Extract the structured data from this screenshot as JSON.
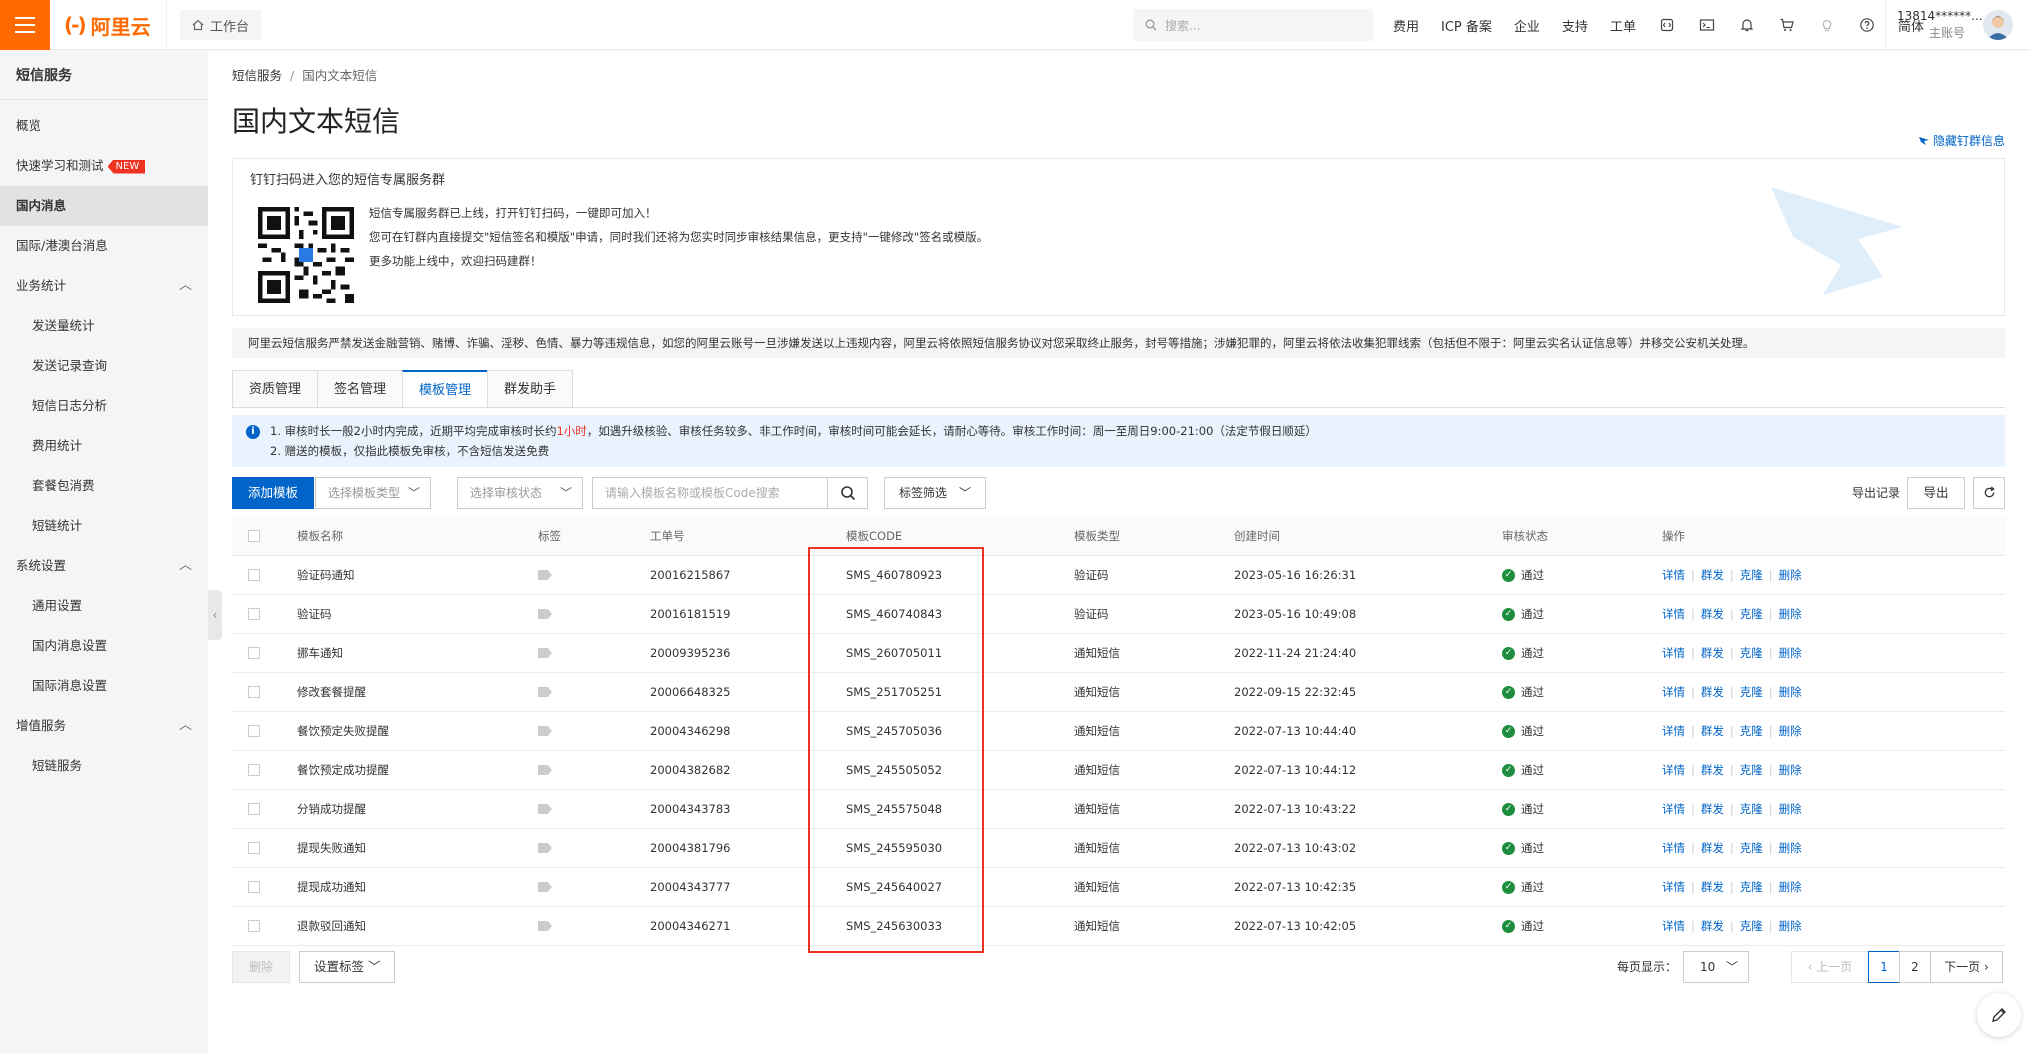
{
  "topbar": {
    "logo_text": "阿里云",
    "logo_mark": "(-)",
    "workbench": "工作台",
    "search_placeholder": "搜索...",
    "links": [
      "费用",
      "ICP 备案",
      "企业",
      "支持",
      "工单"
    ],
    "lang": "简体",
    "account_name": "13814******...",
    "account_role": "主账号"
  },
  "sidebar": {
    "title": "短信服务",
    "items": [
      {
        "label": "概览"
      },
      {
        "label": "快速学习和测试",
        "badge": "NEW"
      },
      {
        "label": "国内消息",
        "active": true
      },
      {
        "label": "国际/港澳台消息"
      },
      {
        "label": "业务统计",
        "group": true
      },
      {
        "label": "发送量统计",
        "sub": true
      },
      {
        "label": "发送记录查询",
        "sub": true
      },
      {
        "label": "短信日志分析",
        "sub": true
      },
      {
        "label": "费用统计",
        "sub": true
      },
      {
        "label": "套餐包消费",
        "sub": true
      },
      {
        "label": "短链统计",
        "sub": true
      },
      {
        "label": "系统设置",
        "group": true
      },
      {
        "label": "通用设置",
        "sub": true
      },
      {
        "label": "国内消息设置",
        "sub": true
      },
      {
        "label": "国际消息设置",
        "sub": true
      },
      {
        "label": "增值服务",
        "group": true
      },
      {
        "label": "短链服务",
        "sub": true
      }
    ]
  },
  "breadcrumb": {
    "root": "短信服务",
    "sep": "/",
    "current": "国内文本短信"
  },
  "page_title": "国内文本短信",
  "hide_link": "隐藏钉群信息",
  "qr_card": {
    "title": "钉钉扫码进入您的短信专属服务群",
    "lines": [
      "短信专属服务群已上线，打开钉钉扫码，一键即可加入！",
      "您可在钉群内直接提交\"短信签名和模版\"申请，同时我们还将为您实时同步审核结果信息，更支持\"一键修改\"签名或模版。",
      "更多功能上线中，欢迎扫码建群！"
    ]
  },
  "warning": "阿里云短信服务严禁发送金融营销、赌博、诈骗、淫秽、色情、暴力等违规信息，如您的阿里云账号一旦涉嫌发送以上违规内容，阿里云将依照短信服务协议对您采取终止服务，封号等措施；涉嫌犯罪的，阿里云将依法收集犯罪线索（包括但不限于：阿里云实名认证信息等）并移交公安机关处理。",
  "tabs": [
    {
      "label": "资质管理"
    },
    {
      "label": "签名管理"
    },
    {
      "label": "模板管理",
      "active": true
    },
    {
      "label": "群发助手"
    }
  ],
  "info": {
    "line1_a": "1. 审核时长一般2小时内完成，近期平均完成审核时长约",
    "line1_red": "1小时",
    "line1_b": "，如遇升级核验、审核任务较多、非工作时间，审核时间可能会延长，请耐心等待。审核工作时间：周一至周日9:00-21:00（法定节假日顺延）",
    "line2": "2. 赠送的模板，仅指此模板免审核，不含短信发送免费"
  },
  "toolbar": {
    "add": "添加模板",
    "type_placeholder": "选择模板类型",
    "status_placeholder": "选择审核状态",
    "search_placeholder": "请输入模板名称或模板Code搜索",
    "tag_filter": "标签筛选",
    "export_records": "导出记录",
    "export": "导出"
  },
  "table": {
    "headers": [
      "模板名称",
      "标签",
      "工单号",
      "模板CODE",
      "模板类型",
      "创建时间",
      "审核状态",
      "操作"
    ],
    "rows": [
      {
        "name": "验证码通知",
        "order": "20016215867",
        "code": "SMS_460780923",
        "type": "验证码",
        "time": "2023-05-16 16:26:31",
        "status": "通过"
      },
      {
        "name": "验证码",
        "order": "20016181519",
        "code": "SMS_460740843",
        "type": "验证码",
        "time": "2023-05-16 10:49:08",
        "status": "通过"
      },
      {
        "name": "挪车通知",
        "order": "20009395236",
        "code": "SMS_260705011",
        "type": "通知短信",
        "time": "2022-11-24 21:24:40",
        "status": "通过"
      },
      {
        "name": "修改套餐提醒",
        "order": "20006648325",
        "code": "SMS_251705251",
        "type": "通知短信",
        "time": "2022-09-15 22:32:45",
        "status": "通过"
      },
      {
        "name": "餐饮预定失败提醒",
        "order": "20004346298",
        "code": "SMS_245705036",
        "type": "通知短信",
        "time": "2022-07-13 10:44:40",
        "status": "通过"
      },
      {
        "name": "餐饮预定成功提醒",
        "order": "20004382682",
        "code": "SMS_245505052",
        "type": "通知短信",
        "time": "2022-07-13 10:44:12",
        "status": "通过"
      },
      {
        "name": "分销成功提醒",
        "order": "20004343783",
        "code": "SMS_245575048",
        "type": "通知短信",
        "time": "2022-07-13 10:43:22",
        "status": "通过"
      },
      {
        "name": "提现失败通知",
        "order": "20004381796",
        "code": "SMS_245595030",
        "type": "通知短信",
        "time": "2022-07-13 10:43:02",
        "status": "通过"
      },
      {
        "name": "提现成功通知",
        "order": "20004343777",
        "code": "SMS_245640027",
        "type": "通知短信",
        "time": "2022-07-13 10:42:35",
        "status": "通过"
      },
      {
        "name": "退款驳回通知",
        "order": "20004346271",
        "code": "SMS_245630033",
        "type": "通知短信",
        "time": "2022-07-13 10:42:05",
        "status": "通过"
      }
    ],
    "actions": [
      "详情",
      "群发",
      "克隆",
      "删除"
    ]
  },
  "footer": {
    "delete": "删除",
    "set_tag": "设置标签",
    "page_size_label": "每页显示：",
    "page_size": "10",
    "prev": "上一页",
    "pages": [
      "1",
      "2"
    ],
    "next": "下一页"
  },
  "colors": {
    "brand": "#ff6a00",
    "primary": "#0064c8",
    "success": "#1e8e3e",
    "highlight": "#e32222"
  }
}
